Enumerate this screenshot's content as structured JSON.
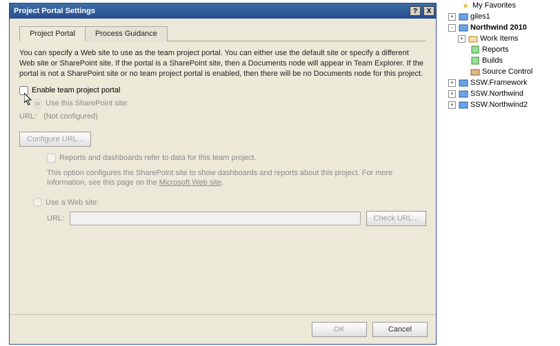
{
  "dialog": {
    "title": "Project Portal Settings",
    "tabs": {
      "portal": "Project Portal",
      "guidance": "Process Guidance"
    },
    "description": "You can specify a Web site to use as the team project portal. You can either use the default site or specify a different Web site or SharePoint site. If the portal is a SharePoint site, then a Documents node will appear in Team Explorer. If the portal is not a SharePoint site or no team project portal is enabled, then there will be no Documents node for this project.",
    "enable_label": "Enable team project portal",
    "use_sp_label": "Use this SharePoint site:",
    "url_label": "URL:",
    "url_not_configured": "(Not configured)",
    "configure_url_btn": "Configure URL...",
    "reports_chk": "Reports and dashboards refer to data for this team project.",
    "option_note_1": "This option configures the SharePoint site to show dashboards and reports about this project. For more information, see this page on the ",
    "option_note_link": "Microsoft Web site",
    "option_note_2": ".",
    "use_web_label": "Use a Web site:",
    "check_url_btn": "Check URL...",
    "ok": "OK",
    "cancel": "Cancel",
    "help_btn": "?",
    "close_btn": "X"
  },
  "tree": {
    "items": [
      {
        "depth": 2,
        "exp": "",
        "icon": "star",
        "label": "My Favorites"
      },
      {
        "depth": 2,
        "exp": "+",
        "icon": "proj",
        "label": "giles1"
      },
      {
        "depth": 2,
        "exp": "-",
        "icon": "proj",
        "label": "Northwind 2010",
        "bold": true
      },
      {
        "depth": 3,
        "exp": "+",
        "icon": "folder",
        "label": "Work Items"
      },
      {
        "depth": 3,
        "exp": "",
        "icon": "report",
        "label": "Reports"
      },
      {
        "depth": 3,
        "exp": "",
        "icon": "build",
        "label": "Builds"
      },
      {
        "depth": 3,
        "exp": "",
        "icon": "src",
        "label": "Source Control"
      },
      {
        "depth": 2,
        "exp": "+",
        "icon": "proj",
        "label": "SSW.Framework"
      },
      {
        "depth": 2,
        "exp": "+",
        "icon": "proj",
        "label": "SSW.Northwind"
      },
      {
        "depth": 2,
        "exp": "+",
        "icon": "proj",
        "label": "SSW.Northwind2"
      }
    ]
  }
}
